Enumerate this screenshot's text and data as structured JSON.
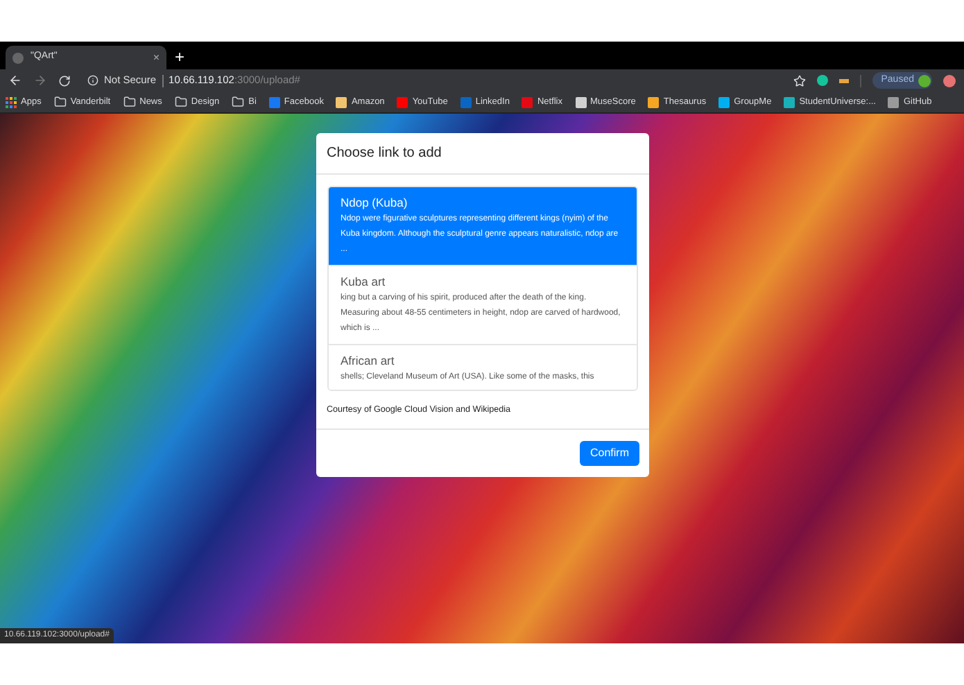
{
  "browser": {
    "tab": {
      "title": "\"QArt\"",
      "close": "×"
    },
    "new_tab": "+",
    "security": "Not Secure",
    "url_host": "10.66.119.102",
    "url_path": ":3000/upload#",
    "profile": "Paused",
    "bookmarks": [
      {
        "kind": "apps",
        "label": "Apps"
      },
      {
        "kind": "folder",
        "label": "Vanderbilt"
      },
      {
        "kind": "folder",
        "label": "News"
      },
      {
        "kind": "folder",
        "label": "Design"
      },
      {
        "kind": "folder",
        "label": "Bi"
      },
      {
        "kind": "site",
        "label": "Facebook",
        "color": "#1877f2"
      },
      {
        "kind": "site",
        "label": "Amazon",
        "color": "#f0c36d"
      },
      {
        "kind": "site",
        "label": "YouTube",
        "color": "#ff0000"
      },
      {
        "kind": "site",
        "label": "LinkedIn",
        "color": "#0a66c2"
      },
      {
        "kind": "site",
        "label": "Netflix",
        "color": "#e50914"
      },
      {
        "kind": "site",
        "label": "MuseScore",
        "color": "#d0d0d0"
      },
      {
        "kind": "site",
        "label": "Thesaurus",
        "color": "#f5a623"
      },
      {
        "kind": "site",
        "label": "GroupMe",
        "color": "#00aff0"
      },
      {
        "kind": "site",
        "label": "StudentUniverse:...",
        "color": "#1ab0b8"
      },
      {
        "kind": "site",
        "label": "GitHub",
        "color": "#9a9a9a"
      }
    ]
  },
  "dialog": {
    "title": "Choose link to add",
    "options": [
      {
        "title": "Ndop (Kuba)",
        "text": "Ndop were figurative sculptures representing different kings (nyim) of the Kuba kingdom. Although the sculptural genre appears naturalistic, ndop are ...",
        "selected": true
      },
      {
        "title": "Kuba art",
        "text": "king but a carving of his spirit, produced after the death of the king. Measuring about 48-55 centimeters in height, ndop are carved of hardwood, which is ...",
        "selected": false
      },
      {
        "title": "African art",
        "text": "shells; Cleveland Museum of Art (USA). Like some of the masks, this",
        "selected": false
      }
    ],
    "credit": "Courtesy of Google Cloud Vision and Wikipedia",
    "confirm": "Confirm"
  },
  "status_url": "10.66.119.102:3000/upload#"
}
